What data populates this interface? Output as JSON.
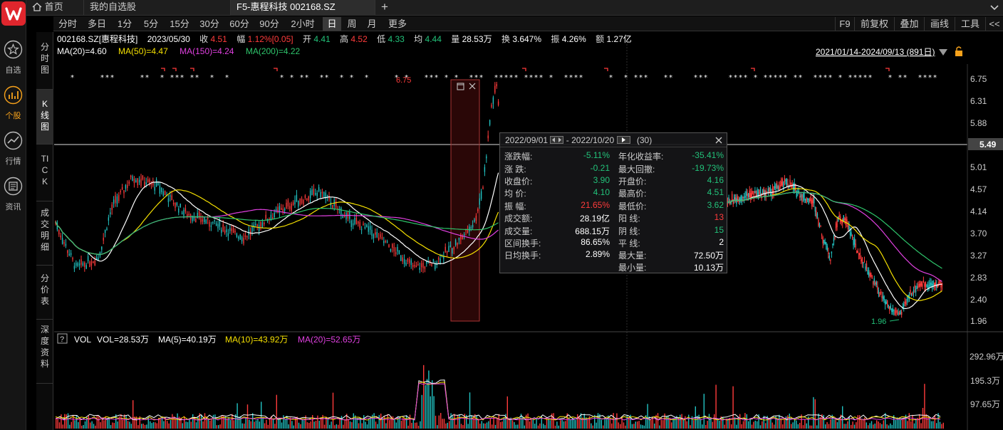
{
  "nav": {
    "items": [
      {
        "label": "自选",
        "icon": "star-icon"
      },
      {
        "label": "个股",
        "icon": "stock-chart-icon",
        "active": true
      },
      {
        "label": "行情",
        "icon": "market-trend-icon"
      },
      {
        "label": "资讯",
        "icon": "news-icon"
      }
    ]
  },
  "tabs": {
    "home": "首页",
    "watchlist": "我的自选股",
    "current": "F5-惠程科技 002168.SZ",
    "add": "+"
  },
  "vtabs": [
    "分时图",
    "K线图",
    "TICK",
    "成交明细",
    "分价表",
    "深度资料"
  ],
  "periods": [
    "分时",
    "多日",
    "1分",
    "5分",
    "15分",
    "30分",
    "60分",
    "90分",
    "2小时",
    "日",
    "周",
    "月",
    "更多"
  ],
  "tools": [
    "F9",
    "前复权",
    "叠加",
    "画线",
    "工具",
    "<<"
  ],
  "quote": {
    "code_name": "002168.SZ[惠程科技]",
    "date": "2023/05/30",
    "close_label": "收",
    "close": "4.51",
    "change_label": "幅",
    "change": "1.12%[0.05]",
    "open_label": "开",
    "open": "4.41",
    "high_label": "高",
    "high": "4.52",
    "low_label": "低",
    "low": "4.33",
    "avg_label": "均",
    "avg": "4.44",
    "vol_label": "量",
    "vol": "28.53万",
    "turn_label": "换",
    "turn": "3.647%",
    "amp_label": "振",
    "amp": "4.26%",
    "amt_label": "额",
    "amt": "1.27亿"
  },
  "ma": {
    "ma20": "MA(20)=4.60",
    "ma50": "MA(50)=4.47",
    "ma150": "MA(150)=4.24",
    "ma200": "MA(200)=4.22"
  },
  "range": "2021/01/14-2024/09/13 (891日)",
  "price_axis": [
    "6.75",
    "6.31",
    "5.88",
    "5.49",
    "5.01",
    "4.57",
    "4.14",
    "3.70",
    "3.27",
    "2.83",
    "2.40",
    "1.96"
  ],
  "markers": {
    "high": "6.75",
    "low": "1.96"
  },
  "vol": {
    "help": "?",
    "name": "VOL",
    "vol": "VOL=28.53万",
    "ma5": "MA(5)=40.19万",
    "ma10": "MA(10)=43.92万",
    "ma20": "MA(20)=52.65万",
    "axis": [
      "292.96万",
      "195.3万",
      "97.65万"
    ]
  },
  "stats": {
    "range_start": "2022/09/01",
    "range_sep": "-",
    "range_end": "2022/10/20",
    "count": "(30)",
    "left": [
      {
        "k": "涨跌幅:",
        "v": "-5.11%",
        "c": "grn"
      },
      {
        "k": "涨  跌:",
        "v": "-0.21",
        "c": "grn"
      },
      {
        "k": "收盘价:",
        "v": "3.90",
        "c": "grn"
      },
      {
        "k": "均  价:",
        "v": "4.10",
        "c": "grn"
      },
      {
        "k": "振  幅:",
        "v": "21.65%",
        "c": "red"
      },
      {
        "k": "成交额:",
        "v": "28.19亿",
        "c": "wht"
      },
      {
        "k": "成交量:",
        "v": "688.15万",
        "c": "wht"
      },
      {
        "k": "区间换手:",
        "v": "86.65%",
        "c": "wht"
      },
      {
        "k": "日均换手:",
        "v": "2.89%",
        "c": "wht"
      }
    ],
    "right": [
      {
        "k": "年化收益率:",
        "v": "-35.41%",
        "c": "grn"
      },
      {
        "k": "最大回撤:",
        "v": "-19.73%",
        "c": "grn"
      },
      {
        "k": "开盘价:",
        "v": "4.16",
        "c": "grn"
      },
      {
        "k": "最高价:",
        "v": "4.51",
        "c": "grn"
      },
      {
        "k": "最低价:",
        "v": "3.62",
        "c": "grn"
      },
      {
        "k": "阳  线:",
        "v": "13",
        "c": "red"
      },
      {
        "k": "阴  线:",
        "v": "15",
        "c": "grn"
      },
      {
        "k": "平  线:",
        "v": "2",
        "c": "wht"
      },
      {
        "k": "最大量:",
        "v": "72.50万",
        "c": "wht"
      },
      {
        "k": "最小量:",
        "v": "10.13万",
        "c": "wht"
      }
    ]
  },
  "colors": {
    "up": "#ff3b3b",
    "down": "#22c2c2",
    "ma20": "#ffffff",
    "ma50": "#f5e000",
    "ma150": "#e040e0",
    "ma200": "#2ec46b",
    "brand": "#e0262d",
    "accent": "#f7a21b"
  }
}
